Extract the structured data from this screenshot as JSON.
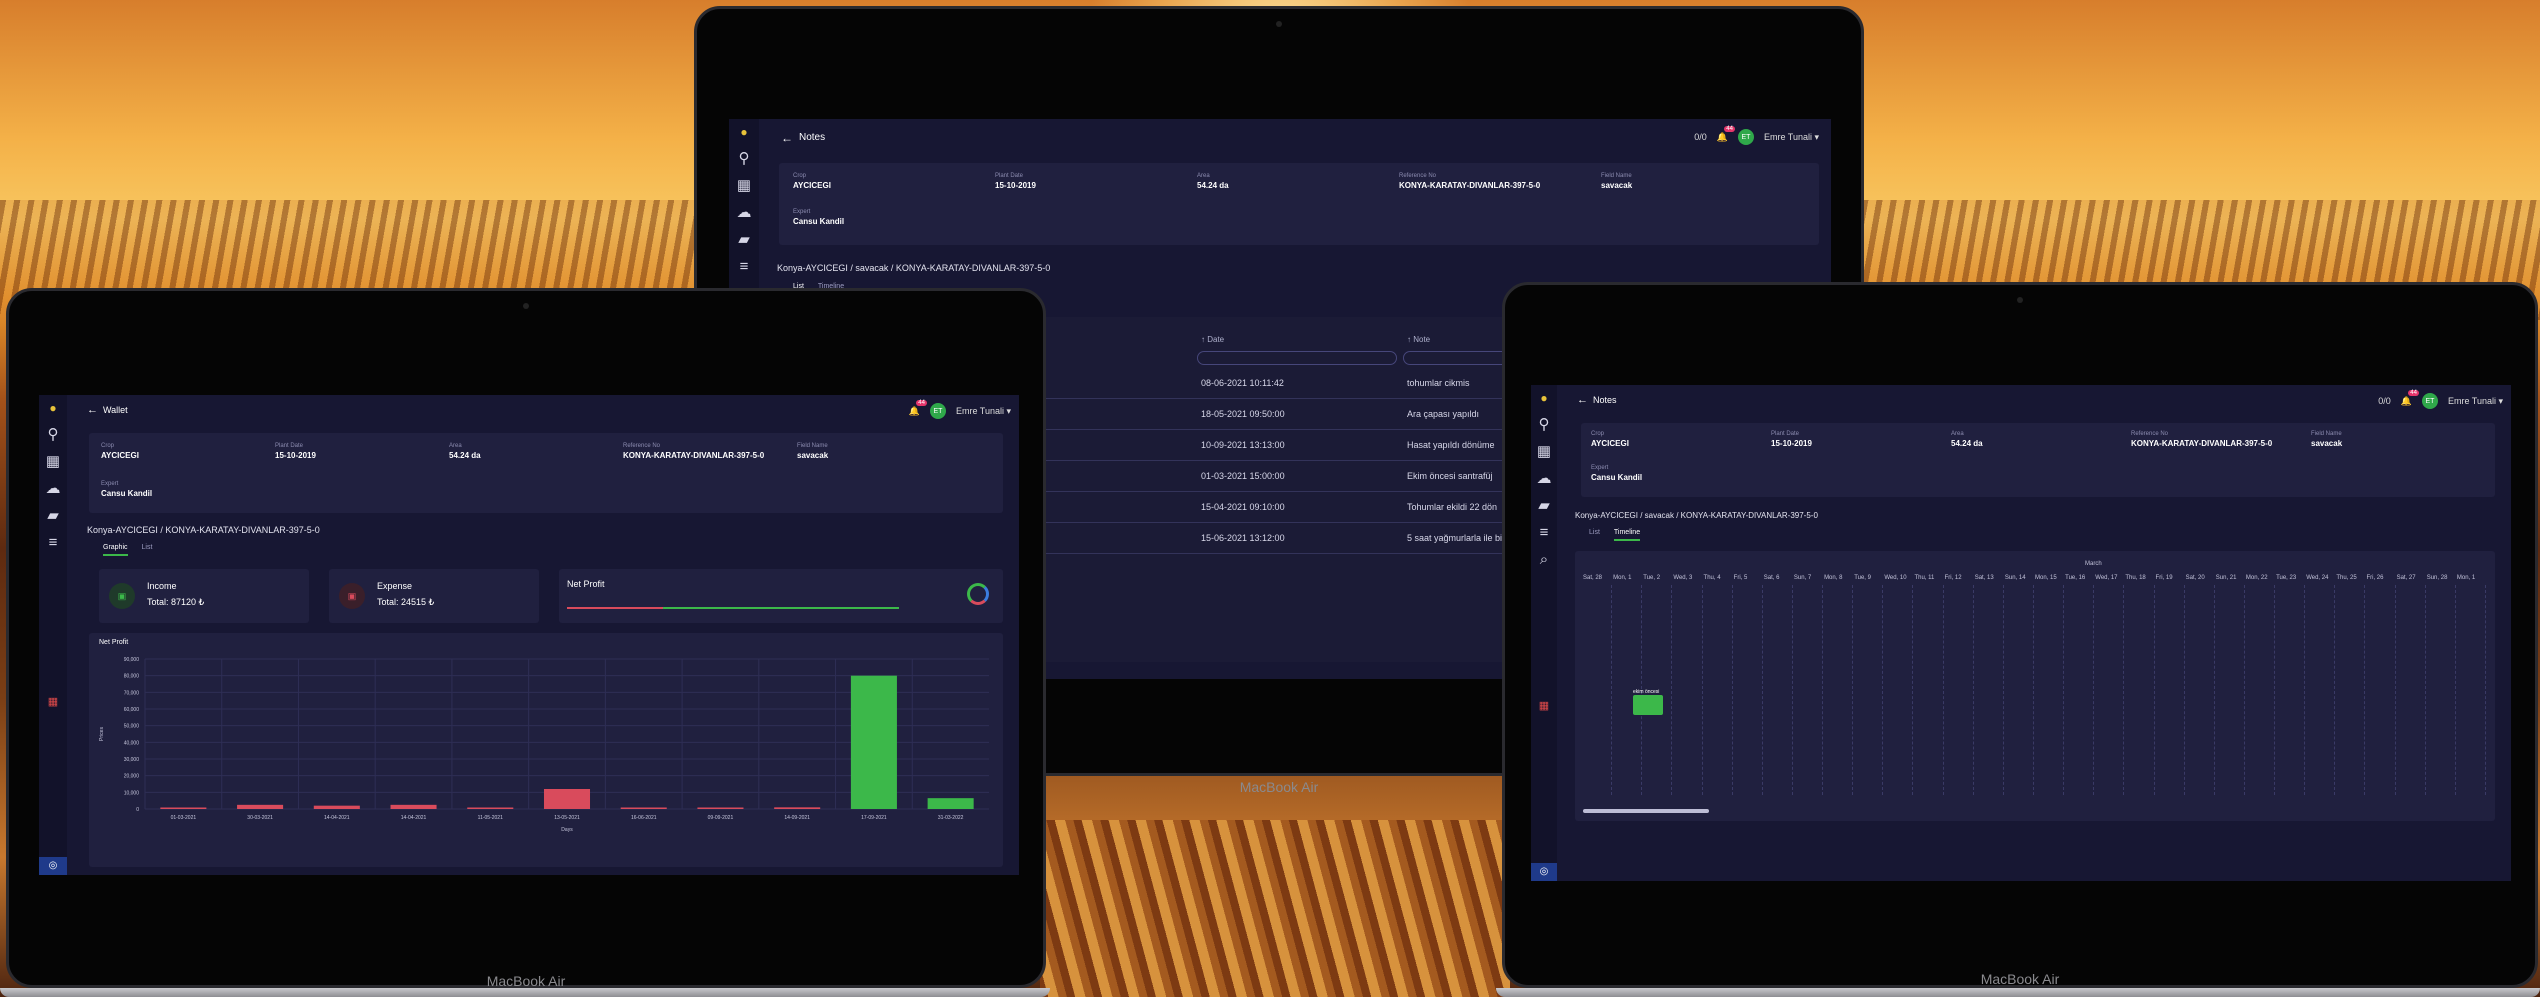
{
  "brand": {
    "device_label": "MacBook Air",
    "accent": "#3cb84a"
  },
  "user": {
    "initials": "ET",
    "name": "Emre Tunali ▾",
    "notifications": "44",
    "messages": "0/0"
  },
  "crop_info": {
    "crop_label": "Crop",
    "crop": "AYCICEGI",
    "plant_date_label": "Plant Date",
    "plant_date": "15-10-2019",
    "area_label": "Area",
    "area": "54.24 da",
    "reference_label": "Reference No",
    "reference": "KONYA-KARATAY-DIVANLAR-397-5-0",
    "field_label": "Field Name",
    "field": "savacak",
    "expert_label": "Expert",
    "expert": "Cansu Kandil"
  },
  "breadcrumb": "Konya-AYCICEGI / savacak / KONYA-KARATAY-DIVANLAR-397-5-0",
  "breadcrumb_short": "Konya-AYCICEGI / KONYA-KARATAY-DIVANLAR-397-5-0",
  "notes_screen": {
    "title": "Notes",
    "tabs": [
      "List",
      "Timeline"
    ],
    "columns": {
      "date": "Date",
      "note": "Note"
    },
    "rows": [
      {
        "date": "08-06-2021 10:11:42",
        "note": "tohumlar cikmis"
      },
      {
        "date": "18-05-2021 09:50:00",
        "note": "Ara çapası yapıldı"
      },
      {
        "date": "10-09-2021 13:13:00",
        "note": "Hasat yapıldı dönüme"
      },
      {
        "date": "01-03-2021 15:00:00",
        "note": "Ekim öncesi santrafüj"
      },
      {
        "date": "15-04-2021 09:10:00",
        "note": "Tohumlar ekildi 22 dön"
      },
      {
        "date": "15-06-2021 13:12:00",
        "note": "5 saat yağmurlarla ile bi"
      }
    ]
  },
  "wallet_screen": {
    "title": "Wallet",
    "tabs": [
      "Graphic",
      "List"
    ],
    "income_label": "Income",
    "income_total": "Total: 87120 ₺",
    "expense_label": "Expense",
    "expense_total": "Total: 24515 ₺",
    "profit_label": "Net Profit",
    "chart_title": "Net Profit"
  },
  "chart_data": {
    "type": "bar",
    "title": "Net Profit",
    "xlabel": "Days",
    "ylabel": "Prices",
    "ylim": [
      0,
      90000
    ],
    "yticks": [
      "90,000",
      "80,000",
      "70,000",
      "60,000",
      "50,000",
      "40,000",
      "30,000",
      "20,000",
      "10,000",
      "0"
    ],
    "categories": [
      "01-03-2021",
      "30-03-2021",
      "14-04-2021",
      "14-04-2021",
      "11-05-2021",
      "13-05-2021",
      "16-06-2021",
      "09-09-2021",
      "14-09-2021",
      "17-09-2021",
      "31-03-2022"
    ],
    "values": [
      300,
      2500,
      2000,
      2500,
      500,
      12000,
      600,
      800,
      1000,
      80000,
      6500
    ],
    "colors": [
      "#d94b5c",
      "#d94b5c",
      "#d94b5c",
      "#d94b5c",
      "#d94b5c",
      "#d94b5c",
      "#d94b5c",
      "#d94b5c",
      "#d94b5c",
      "#3cb84a",
      "#3cb84a"
    ],
    "grid": true
  },
  "timeline_screen": {
    "title": "Notes",
    "tabs": [
      "List",
      "Timeline"
    ],
    "month": "March",
    "days": [
      "Sat, 28",
      "Mon, 1",
      "Tue, 2",
      "Wed, 3",
      "Thu, 4",
      "Fri, 5",
      "Sat, 6",
      "Sun, 7",
      "Mon, 8",
      "Tue, 9",
      "Wed, 10",
      "Thu, 11",
      "Fri, 12",
      "Sat, 13",
      "Sun, 14",
      "Mon, 15",
      "Tue, 16",
      "Wed, 17",
      "Thu, 18",
      "Fri, 19",
      "Sat, 20",
      "Sun, 21",
      "Mon, 22",
      "Tue, 23",
      "Wed, 24",
      "Thu, 25",
      "Fri, 26",
      "Sat, 27",
      "Sun, 28",
      "Mon, 1"
    ],
    "event_label": "ekim öncesi"
  }
}
